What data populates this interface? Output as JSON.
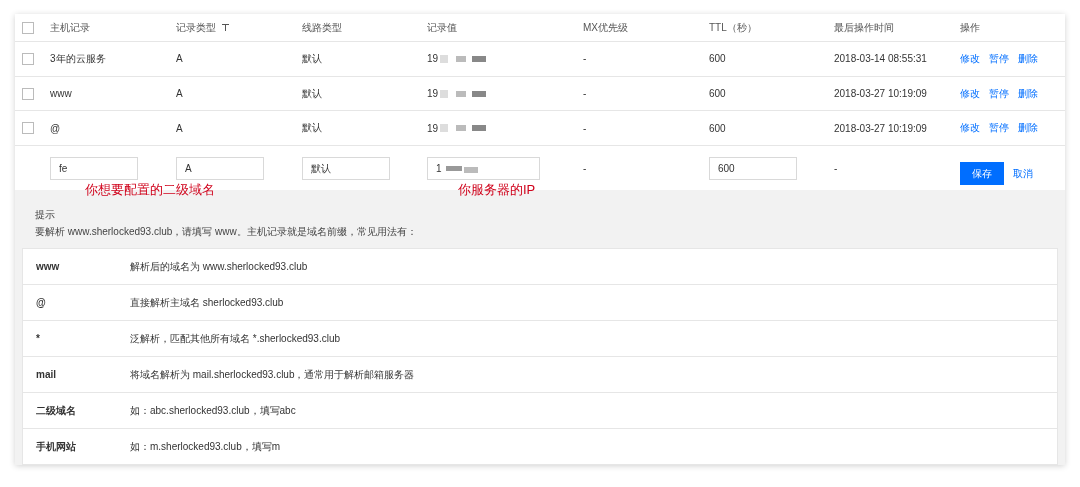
{
  "table": {
    "select_all": {
      "checked": false
    },
    "columns": [
      {
        "label": "主机记录",
        "filter": false
      },
      {
        "label": "记录类型",
        "filter": true
      },
      {
        "label": "线路类型",
        "filter": false
      },
      {
        "label": "记录值",
        "filter": false
      },
      {
        "label": "MX优先级",
        "filter": false
      },
      {
        "label": "TTL（秒）",
        "filter": false
      },
      {
        "label": "最后操作时间",
        "filter": false
      },
      {
        "label": "操作",
        "filter": false
      }
    ],
    "rows": [
      {
        "checked": false,
        "host": "3年的云服务",
        "type": "A",
        "line": "默认",
        "value": "19",
        "mx": "-",
        "ttl": "600",
        "time": "2018-03-14 08:55:31",
        "actions": [
          "修改",
          "暂停",
          "删除"
        ]
      },
      {
        "checked": false,
        "host": "www",
        "type": "A",
        "line": "默认",
        "value": "19",
        "mx": "-",
        "ttl": "600",
        "time": "2018-03-27 10:19:09",
        "actions": [
          "修改",
          "暂停",
          "删除"
        ]
      },
      {
        "checked": false,
        "host": "@",
        "type": "A",
        "line": "默认",
        "value": "19",
        "mx": "-",
        "ttl": "600",
        "time": "2018-03-27 10:19:09",
        "actions": [
          "修改",
          "暂停",
          "删除"
        ]
      }
    ],
    "new_row": {
      "host": "fe",
      "type": "A",
      "line": "默认",
      "value": "1",
      "mx": "-",
      "ttl": "600",
      "time": "-",
      "buttons": [
        {
          "label": "保存",
          "kind": "primary"
        },
        {
          "label": "取消",
          "kind": "link"
        }
      ]
    }
  },
  "annotations": [
    {
      "text": "你想要配置的二级域名"
    },
    {
      "text": "你服务器的IP"
    }
  ],
  "hint": {
    "title": "提示",
    "text": "要解析 www.sherlocked93.club，请填写 www。主机记录就是域名前缀，常见用法有：",
    "rows": [
      {
        "key": "www",
        "desc": "解析后的域名为 www.sherlocked93.club"
      },
      {
        "key": "@",
        "desc": "直接解析主域名 sherlocked93.club"
      },
      {
        "key": "*",
        "desc": "泛解析，匹配其他所有域名 *.sherlocked93.club"
      },
      {
        "key": "mail",
        "desc": "将域名解析为 mail.sherlocked93.club，通常用于解析邮箱服务器"
      },
      {
        "key": "二级域名",
        "desc": "如：abc.sherlocked93.club，填写abc"
      },
      {
        "key": "手机网站",
        "desc": "如：m.sherlocked93.club，填写m"
      }
    ]
  }
}
